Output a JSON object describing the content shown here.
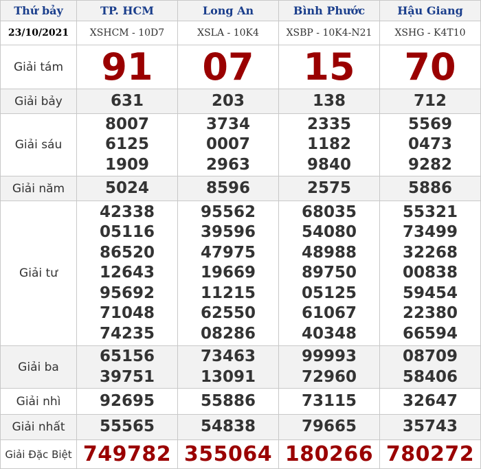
{
  "header": {
    "day": "Thứ bảy",
    "provinces": [
      "TP. HCM",
      "Long An",
      "Bình Phước",
      "Hậu Giang"
    ]
  },
  "date_row": {
    "date": "23/10/2021",
    "codes": [
      "XSHCM - 10D7",
      "XSLA - 10K4",
      "XSBP - 10K4-N21",
      "XSHG - K4T10"
    ]
  },
  "prizes": {
    "giai_tam": {
      "label": "Giải tám",
      "values": [
        "91",
        "07",
        "15",
        "70"
      ]
    },
    "giai_bay": {
      "label": "Giải bảy",
      "values": [
        "631",
        "203",
        "138",
        "712"
      ]
    },
    "giai_sau": {
      "label": "Giải sáu",
      "values": [
        [
          "8007",
          "6125",
          "1909"
        ],
        [
          "3734",
          "0007",
          "2963"
        ],
        [
          "2335",
          "1182",
          "9840"
        ],
        [
          "5569",
          "0473",
          "9282"
        ]
      ]
    },
    "giai_nam": {
      "label": "Giải năm",
      "values": [
        "5024",
        "8596",
        "2575",
        "5886"
      ]
    },
    "giai_tu": {
      "label": "Giải tư",
      "values": [
        [
          "42338",
          "05116",
          "86520",
          "12643",
          "95692",
          "71048",
          "74235"
        ],
        [
          "95562",
          "39596",
          "47975",
          "19669",
          "11215",
          "62550",
          "08286"
        ],
        [
          "68035",
          "54080",
          "48988",
          "89750",
          "05125",
          "61067",
          "40348"
        ],
        [
          "55321",
          "73499",
          "32268",
          "00838",
          "59454",
          "22380",
          "66594"
        ]
      ]
    },
    "giai_ba": {
      "label": "Giải ba",
      "values": [
        [
          "65156",
          "39751"
        ],
        [
          "73463",
          "13091"
        ],
        [
          "99993",
          "72960"
        ],
        [
          "08709",
          "58406"
        ]
      ]
    },
    "giai_nhi": {
      "label": "Giải nhì",
      "values": [
        "92695",
        "55886",
        "73115",
        "32647"
      ]
    },
    "giai_nhat": {
      "label": "Giải nhất",
      "values": [
        "55565",
        "54838",
        "79665",
        "35743"
      ]
    },
    "giai_dac_biet": {
      "label": "Giải Đặc Biệt",
      "values": [
        "749782",
        "355064",
        "180266",
        "780272"
      ]
    }
  },
  "colors": {
    "header_text": "#1a3e8c",
    "highlight_number": "#9a0000",
    "regular_number": "#333333",
    "shaded_row": "#f2f2f2",
    "grid_line": "#c8c8c8"
  }
}
